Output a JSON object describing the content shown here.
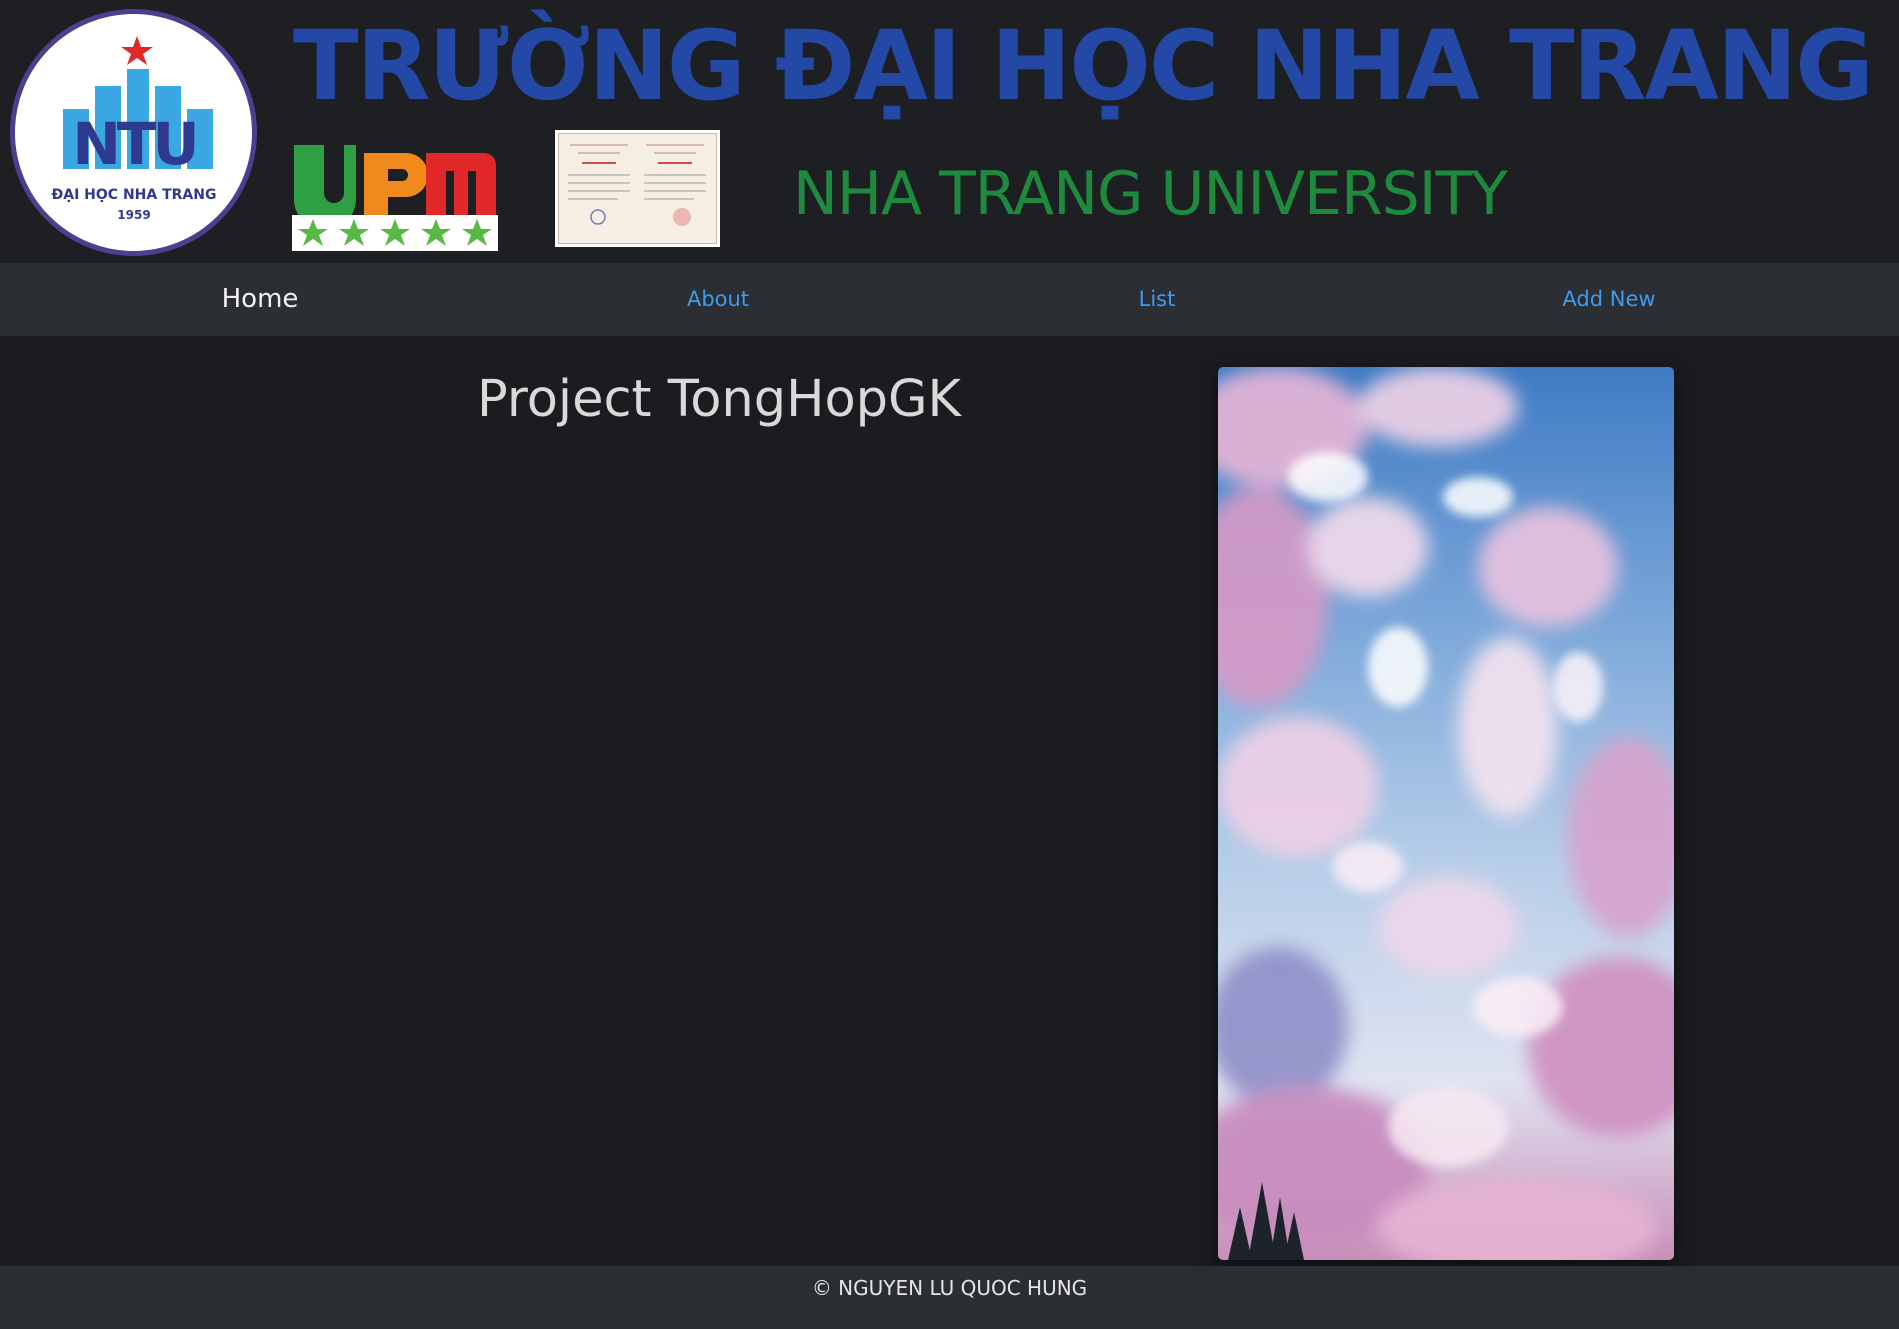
{
  "banner": {
    "title": "TRƯỜNG ĐẠI HỌC NHA TRANG",
    "subtitle": "NHA TRANG UNIVERSITY",
    "seal_letters": "NTU",
    "seal_caption": "ĐẠI HỌC NHA TRANG",
    "seal_year": "1959",
    "upm_logo_text": "UPM",
    "upm_rating_stars": 5
  },
  "nav": {
    "items": [
      {
        "label": "Home",
        "active": true
      },
      {
        "label": "About",
        "active": false
      },
      {
        "label": "List",
        "active": false
      },
      {
        "label": "Add New",
        "active": false
      }
    ]
  },
  "main": {
    "title": "Project TongHopGK"
  },
  "footer": {
    "text": "© NGUYEN LU QUOC HUNG"
  },
  "colors": {
    "background": "#1a1c1f",
    "navbar": "#2b2e32",
    "link": "#3d9cf0",
    "banner_title": "#2348a6",
    "banner_subtitle": "#1e8a3e"
  }
}
